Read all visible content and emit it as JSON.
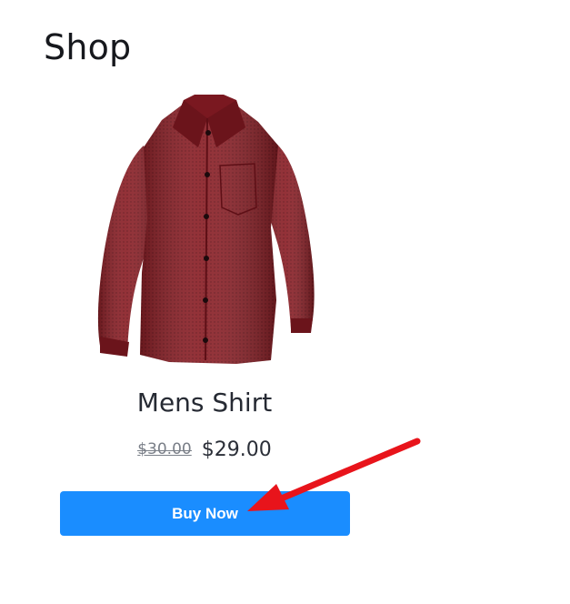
{
  "page": {
    "title": "Shop"
  },
  "product": {
    "name": "Mens Shirt",
    "original_price": "$30.00",
    "sale_price": "$29.00",
    "image_icon": "shirt-image",
    "shirt_color": "#8a1f26"
  },
  "actions": {
    "buy_label": "Buy Now"
  },
  "theme": {
    "accent": "#1a8dff",
    "annotation": "#e8141b"
  }
}
